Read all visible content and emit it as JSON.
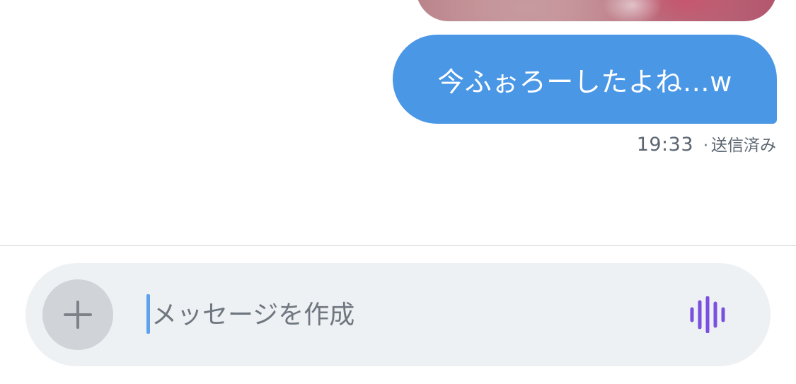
{
  "conversation": {
    "sent_message": {
      "text": "今ふぉろーしたよね…w",
      "time": "19:33",
      "separator": "·",
      "status": "送信済み"
    }
  },
  "composer": {
    "placeholder": "メッセージを作成",
    "value": "",
    "add_icon": "plus-icon",
    "voice_icon": "voice-waveform-icon"
  },
  "colors": {
    "bubble": "#4a97e6",
    "composer_bg": "#eef1f3",
    "voice_icon": "#7b4fe0"
  }
}
